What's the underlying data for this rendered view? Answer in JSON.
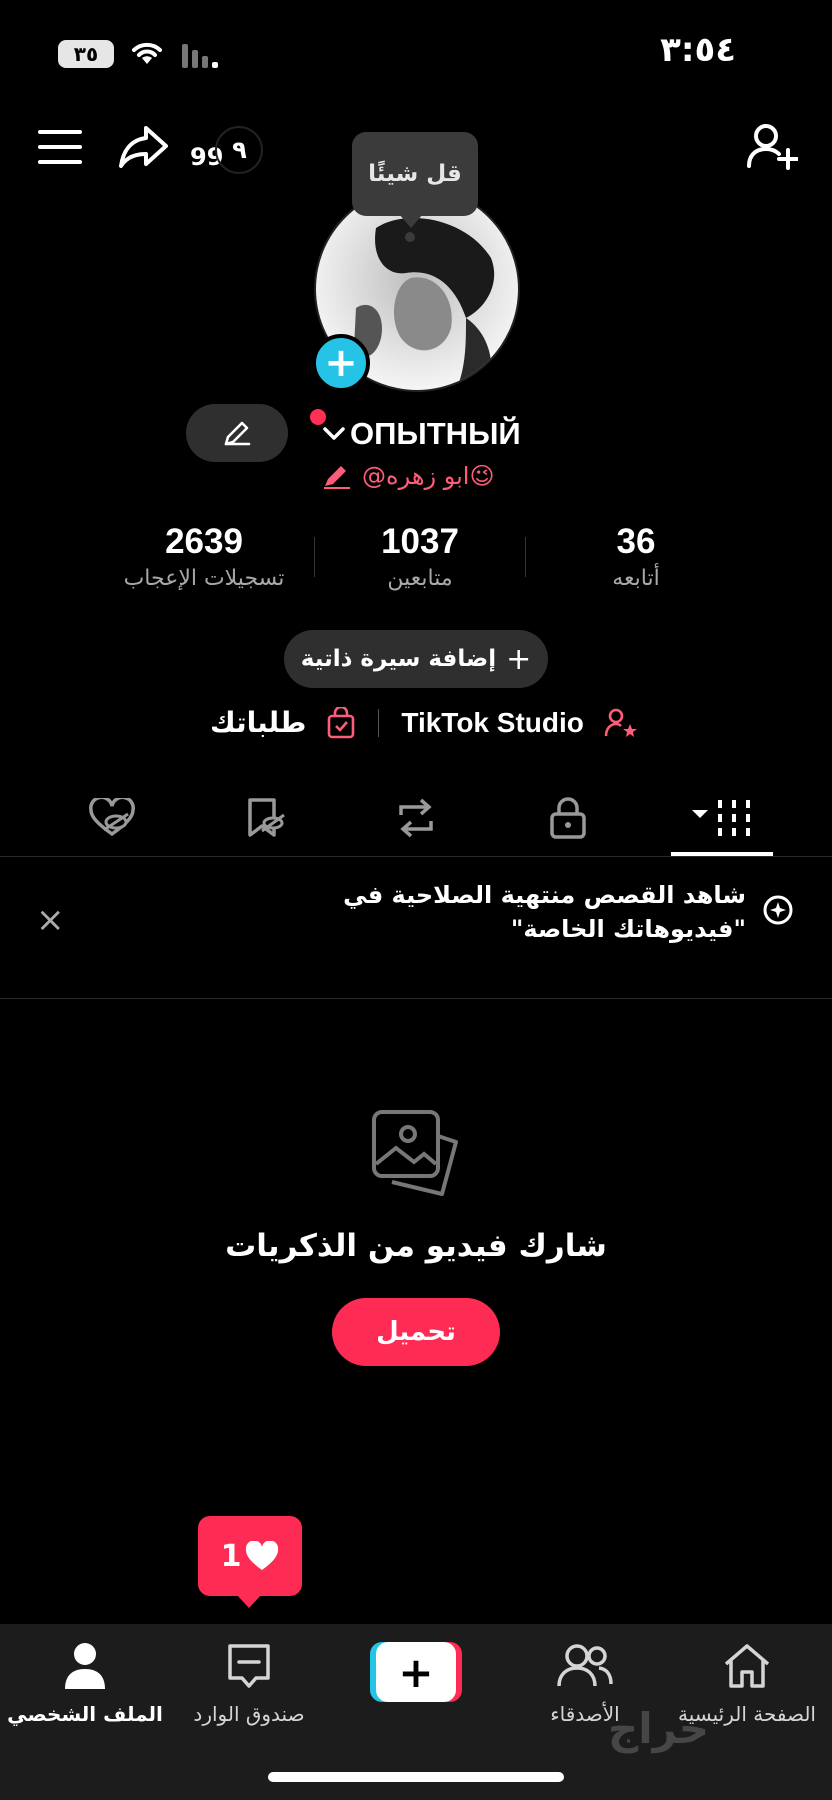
{
  "status_bar": {
    "battery": "٣٥",
    "time": "٣:٥٤"
  },
  "header": {
    "notification_count": "99",
    "notification_badge": "٩"
  },
  "avatar": {
    "tooltip": "قل شيئًا",
    "add_symbol": "+"
  },
  "profile": {
    "username": "ОПЫТНЫЙ",
    "handle": "@ابو زهره😉"
  },
  "stats": [
    {
      "value": "2639",
      "label": "تسجيلات الإعجاب"
    },
    {
      "value": "1037",
      "label": "متابعين"
    },
    {
      "value": "36",
      "label": "أتابعه"
    }
  ],
  "bio_button": {
    "plus": "+",
    "label": "إضافة سيرة ذاتية"
  },
  "links": {
    "orders": "طلباتك",
    "studio": "TikTok Studio"
  },
  "banner": {
    "text": "شاهد القصص منتهية الصلاحية في \"فيديوهاتك الخاصة\"",
    "close": "×"
  },
  "empty_state": {
    "title": "شارك فيديو من الذكريات",
    "button": "تحميل"
  },
  "like_bubble": {
    "count": "1"
  },
  "nav": {
    "profile": "الملف الشخصي",
    "inbox": "صندوق الوارد",
    "create": "+",
    "friends": "الأصدقاء",
    "home": "الصفحة الرئيسية"
  },
  "watermark": "حراج",
  "colors": {
    "accent": "#fe2c55",
    "cyan": "#25c4e6",
    "background": "#000000"
  }
}
